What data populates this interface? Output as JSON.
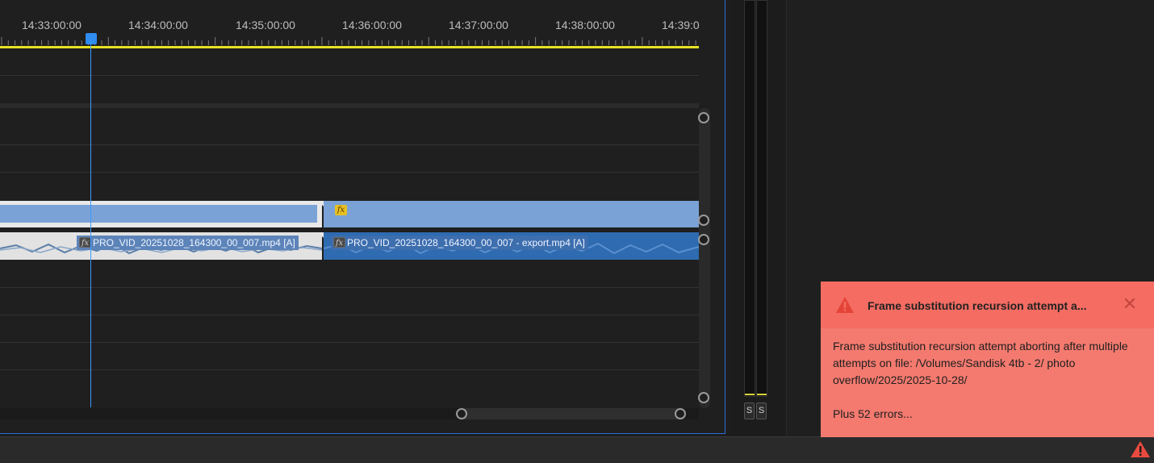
{
  "timeline": {
    "ruler_labels": [
      "14:33:00:00",
      "14:34:00:00",
      "14:35:00:00",
      "14:36:00:00",
      "14:37:00:00",
      "14:38:00:00",
      "14:39:0"
    ],
    "clips": {
      "a2_left_label": "PRO_VID_20251028_164300_00_007.mp4 [A]",
      "a2_right_label": "PRO_VID_20251028_164300_00_007 - export.mp4 [A]",
      "fx_label": "fx"
    },
    "colors": {
      "playhead": "#2f8cf0",
      "work_area": "#e8e024",
      "clip_blue": "#7aa2d6"
    }
  },
  "meters": {
    "solo_left": "S",
    "solo_right": "S"
  },
  "toast": {
    "title": "Frame substitution recursion attempt a...",
    "message": "Frame substitution recursion attempt aborting after multiple attempts on file: /Volumes/Sandisk 4tb - 2/ photo overflow/2025/2025-10-28/",
    "extra": "Plus 52 errors...",
    "close_icon": "close-icon",
    "warning_icon": "warning-icon",
    "color": "#f47a6f"
  },
  "status_bar": {
    "warning_icon": "warning-icon"
  }
}
